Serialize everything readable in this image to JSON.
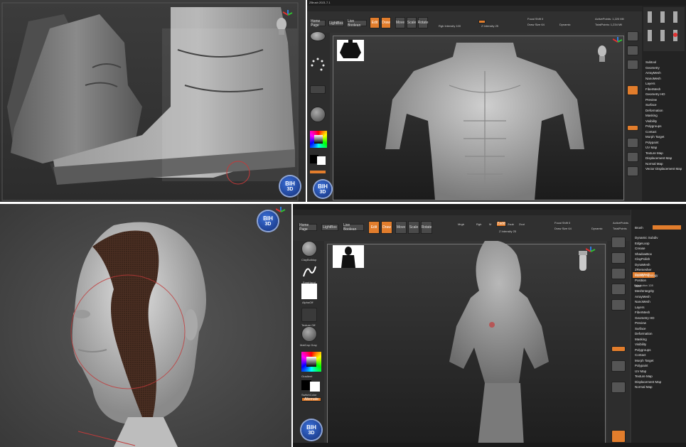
{
  "logo": {
    "line1": "BIH",
    "line2": "3D"
  },
  "panel2": {
    "title": "ZBrush 2021.7.1",
    "buttons": {
      "home": "Home Page",
      "lightbox": "LightBox",
      "live_boolean": "Live Boolean",
      "edit": "Edit",
      "draw": "Draw",
      "move": "Move",
      "scale": "Scale",
      "rotate": "Rotate"
    },
    "readouts": {
      "focal": "Focal Shift 0",
      "draw_size": "Draw Size 64",
      "dynamic": "Dynamic",
      "active_points": "ActivePoints: 1,220 Mil",
      "total_points": "TotalPoints: 1,234 Mil",
      "rgb_intensity": "Rgb Intensity 100",
      "z_intensity": "Z Intensity 25"
    },
    "right_menu": [
      "Subtool",
      "Geometry",
      "ArrayMesh",
      "NanoMesh",
      "Layers",
      "FiberMesh",
      "Geometry HD",
      "Preview",
      "Surface",
      "Deformation",
      "Masking",
      "Visibility",
      "Polygroups",
      "Contact",
      "Morph Target",
      "Polypaint",
      "UV Map",
      "Texture Map",
      "Displacement Map",
      "Normal Map",
      "Vector Displacement Map"
    ]
  },
  "panel4": {
    "buttons": {
      "home": "Home Page",
      "lightbox": "LightBox",
      "live_boolean": "Live Boolean",
      "edit": "Edit",
      "draw": "Draw",
      "move": "Move",
      "scale": "Scale",
      "rotate": "Rotate",
      "mrgb": "Mrgb",
      "rgb": "Rgb",
      "m": "M",
      "zadd": "Zadd",
      "zsub": "Zsub",
      "zcut": "Zcut"
    },
    "readouts": {
      "focal": "Focal Shift 0",
      "draw_size": "Draw Size 64",
      "dynamic": "Dynamic",
      "active_points": "ActivePoints",
      "total_points": "TotalPoints",
      "z_intensity": "Z Intensity 25"
    },
    "left_labels": {
      "brush": "ClayBuildup",
      "stroke": "FreeHand",
      "alpha": "AlphaOff",
      "texture": "Texture Off",
      "material": "MatCap Gray",
      "gradient": "Gradient",
      "switch": "SwitchColor",
      "alternate": "Alternate"
    },
    "right_menu": [
      "Dynamic Subdiv",
      "EdgeLoop",
      "Crease",
      "ShadowBox",
      "ClayPolish",
      "DynaMesh",
      "ZRemesher",
      "Modify Topology",
      "Position",
      "Size",
      "MeshIntegrity",
      "ArrayMesh",
      "NanoMesh",
      "Layers",
      "FiberMesh",
      "Geometry HD",
      "Preview",
      "Surface",
      "Deformation",
      "Masking",
      "Visibility",
      "Polygroups",
      "Contact",
      "Morph Target",
      "Polypaint",
      "UV Map",
      "Texture Map",
      "Displacement Map",
      "Normal Map"
    ],
    "right_header": {
      "brush": "Brush",
      "dynamesh": "DynaMesh",
      "resolution": "Resolution 128"
    }
  }
}
